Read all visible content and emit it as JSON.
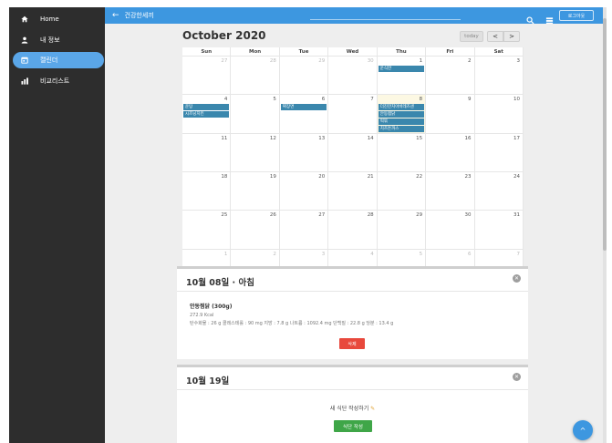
{
  "sidebar": {
    "items": [
      {
        "label": "Home",
        "icon": "home-icon",
        "active": false
      },
      {
        "label": "내 정보",
        "icon": "person-icon",
        "active": false
      },
      {
        "label": "캘린더",
        "icon": "calendar-icon",
        "active": true
      },
      {
        "label": "비교리스트",
        "icon": "chart-icon",
        "active": false
      }
    ]
  },
  "topbar": {
    "back_icon": "←",
    "title": "건강한세끼",
    "logout_label": "로그아웃"
  },
  "calendar": {
    "title": "October 2020",
    "today_label": "today",
    "prev_label": "<",
    "next_label": ">",
    "weekdays": [
      "Sun",
      "Mon",
      "Tue",
      "Wed",
      "Thu",
      "Fri",
      "Sat"
    ],
    "weeks": [
      [
        {
          "d": "27",
          "o": true
        },
        {
          "d": "28",
          "o": true
        },
        {
          "d": "29",
          "o": true
        },
        {
          "d": "30",
          "o": true
        },
        {
          "d": "1",
          "events": [
            "운식한"
          ]
        },
        {
          "d": "2"
        },
        {
          "d": "3"
        }
      ],
      [
        {
          "d": "4",
          "events": [
            "운탕",
            "시즈닝치킨"
          ]
        },
        {
          "d": "5"
        },
        {
          "d": "6",
          "events": [
            "짜장면"
          ]
        },
        {
          "d": "7"
        },
        {
          "d": "8",
          "today": true,
          "events": [
            "더진한치아바레즈샌",
            "안동찜닭",
            "떡볶",
            "치즈돈까스"
          ]
        },
        {
          "d": "9"
        },
        {
          "d": "10"
        }
      ],
      [
        {
          "d": "11"
        },
        {
          "d": "12"
        },
        {
          "d": "13"
        },
        {
          "d": "14"
        },
        {
          "d": "15"
        },
        {
          "d": "16"
        },
        {
          "d": "17"
        }
      ],
      [
        {
          "d": "18"
        },
        {
          "d": "19"
        },
        {
          "d": "20"
        },
        {
          "d": "21"
        },
        {
          "d": "22"
        },
        {
          "d": "23"
        },
        {
          "d": "24"
        }
      ],
      [
        {
          "d": "25"
        },
        {
          "d": "26"
        },
        {
          "d": "27"
        },
        {
          "d": "28"
        },
        {
          "d": "29"
        },
        {
          "d": "30"
        },
        {
          "d": "31"
        }
      ],
      [
        {
          "d": "1",
          "o": true
        },
        {
          "d": "2",
          "o": true
        },
        {
          "d": "3",
          "o": true
        },
        {
          "d": "4",
          "o": true
        },
        {
          "d": "5",
          "o": true
        },
        {
          "d": "6",
          "o": true
        },
        {
          "d": "7",
          "o": true
        }
      ]
    ]
  },
  "meal_panel": {
    "title": "10월 08일 · 아침",
    "food_name": "안동찜닭 (300g)",
    "kcal": "272.9 Kcal",
    "nutrients": "탄수화물 : 26 g  콜레스테롤 : 90 mg  지방 : 7.8 g  나트륨 : 1092.4 mg  단백질 : 22.8 g  당분 : 13.4 g",
    "delete_label": "삭제"
  },
  "new_panel": {
    "title": "10월 19일",
    "prompt": "새 식단 작성하기",
    "add_label": "식단 작성"
  },
  "fab_icon": "^",
  "colors": {
    "primary": "#3d97e0",
    "sidebar": "#2d2d2d",
    "event": "#3a87ad",
    "delete": "#e8483c",
    "add": "#3fa648"
  }
}
